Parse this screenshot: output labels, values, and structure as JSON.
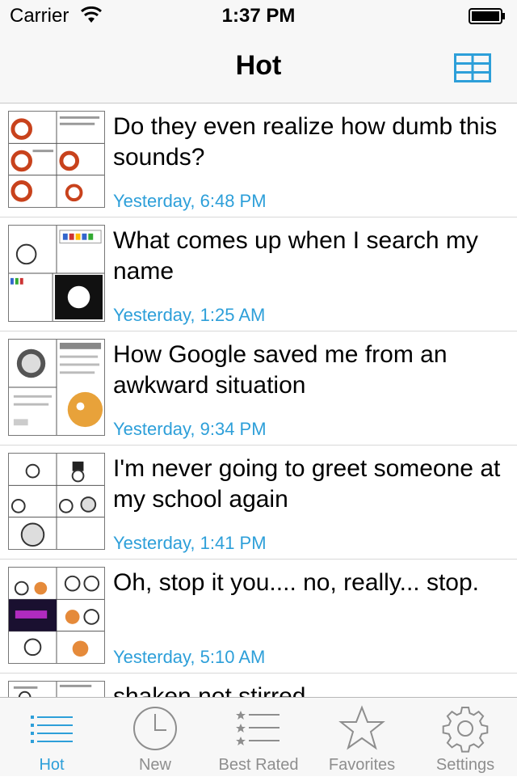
{
  "status_bar": {
    "carrier": "Carrier",
    "time": "1:37 PM"
  },
  "nav": {
    "title": "Hot",
    "right_icon": "grid-view-icon"
  },
  "colors": {
    "accent": "#2d9fd9",
    "inactive": "#8e8e8e",
    "bar_background": "#f7f7f7"
  },
  "posts": [
    {
      "title": "Do they even realize how dumb this sounds?",
      "date": "Yesterday, 6:48 PM"
    },
    {
      "title": "What comes up when I search my name",
      "date": "Yesterday, 1:25 AM"
    },
    {
      "title": "How Google saved me from an awkward situation",
      "date": "Yesterday, 9:34 PM"
    },
    {
      "title": "I'm never going to greet someone at my school again",
      "date": "Yesterday, 1:41 PM"
    },
    {
      "title": "Oh, stop it you.... no, really... stop.",
      "date": "Yesterday, 5:10 AM"
    },
    {
      "title": "shaken not stirred",
      "date": ""
    }
  ],
  "tabs": [
    {
      "label": "Hot",
      "icon": "list-icon",
      "active": true
    },
    {
      "label": "New",
      "icon": "clock-icon",
      "active": false
    },
    {
      "label": "Best Rated",
      "icon": "star-list-icon",
      "active": false
    },
    {
      "label": "Favorites",
      "icon": "star-icon",
      "active": false
    },
    {
      "label": "Settings",
      "icon": "gear-icon",
      "active": false
    }
  ]
}
